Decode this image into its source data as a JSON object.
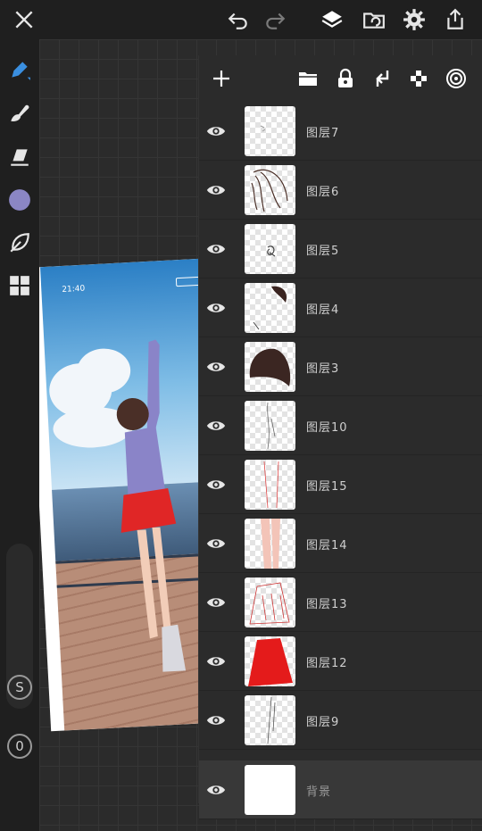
{
  "canvas": {
    "background_color": "#2b2b2b",
    "grid_color": "#353535"
  },
  "topbar": {
    "icons": [
      "close-icon",
      "undo-icon",
      "redo-icon",
      "layers-icon",
      "gallery-icon",
      "settings-icon",
      "share-icon"
    ]
  },
  "left_toolbar": {
    "tools": [
      "pen-icon",
      "smudge-icon",
      "eraser-icon",
      "color-swatch",
      "leaf-brush-icon",
      "grid-view-icon"
    ],
    "current_color": "#8b86c4",
    "accent_color": "#3a8fe0",
    "s_button_label": "S",
    "zero_button_label": "0"
  },
  "artwork": {
    "status_time": "21:40"
  },
  "layers_panel": {
    "toolbar_icons": [
      "add-layer-icon",
      "folder-icon",
      "lock-icon",
      "merge-down-icon",
      "alpha-lock-icon",
      "reference-icon"
    ],
    "layers": [
      {
        "name": "图层7",
        "thumb": "sketch"
      },
      {
        "name": "图层6",
        "thumb": "hair-lines"
      },
      {
        "name": "图层5",
        "thumb": "small-scribble"
      },
      {
        "name": "图层4",
        "thumb": "hair-tip"
      },
      {
        "name": "图层3",
        "thumb": "hair-dark"
      },
      {
        "name": "图层10",
        "thumb": "thin-lines"
      },
      {
        "name": "图层15",
        "thumb": "red-lines"
      },
      {
        "name": "图层14",
        "thumb": "skin-legs"
      },
      {
        "name": "图层13",
        "thumb": "red-skirt-lines"
      },
      {
        "name": "图层12",
        "thumb": "red-skirt"
      },
      {
        "name": "图层9",
        "thumb": "leg-lines"
      },
      {
        "name": "背景",
        "thumb": "white",
        "selected": true
      }
    ]
  }
}
